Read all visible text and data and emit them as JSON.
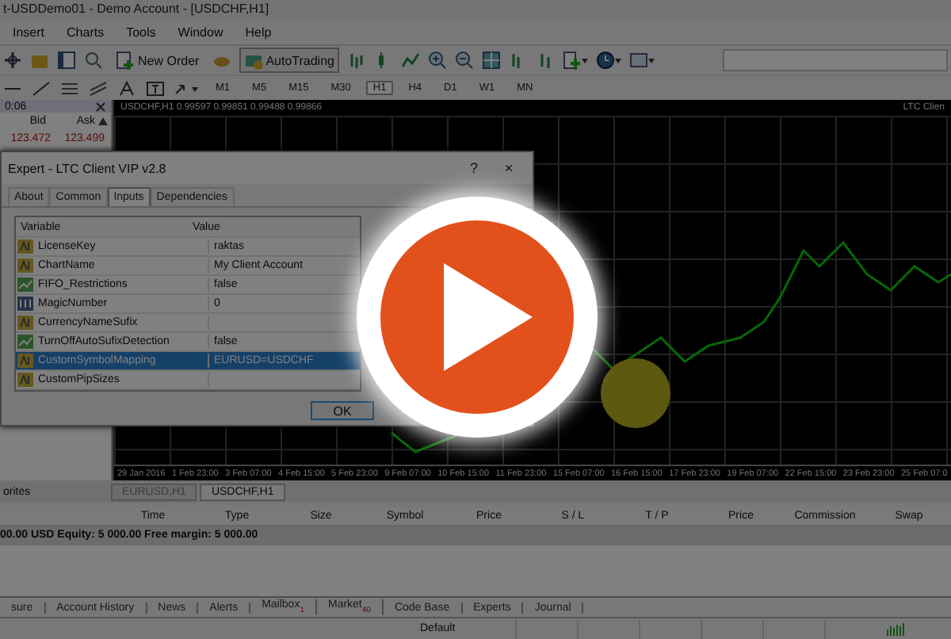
{
  "window": {
    "title": "t-USDDemo01 - Demo Account - [USDCHF,H1]"
  },
  "menu": [
    "Insert",
    "Charts",
    "Tools",
    "Window",
    "Help"
  ],
  "toolbar": {
    "buttons": [
      "New Order",
      "AutoTrading"
    ]
  },
  "timeframes": [
    {
      "label": "M1",
      "selected": false
    },
    {
      "label": "M5",
      "selected": false
    },
    {
      "label": "M15",
      "selected": false
    },
    {
      "label": "M30",
      "selected": false
    },
    {
      "label": "H1",
      "selected": true
    },
    {
      "label": "H4",
      "selected": false
    },
    {
      "label": "D1",
      "selected": false
    },
    {
      "label": "W1",
      "selected": false
    },
    {
      "label": "MN",
      "selected": false
    }
  ],
  "market_watch": {
    "header": "0:06",
    "columns": [
      "Bid",
      "Ask"
    ],
    "rows": [
      [
        "123.472",
        "123.499"
      ]
    ]
  },
  "chart": {
    "header": "USDCHF,H1  0.99597 0.99851 0.99488 0.99866",
    "expert_label": "LTC Clien",
    "x_labels": [
      "29 Jan 2016",
      "1 Feb 23:00",
      "3 Feb 07:00",
      "4 Feb 15:00",
      "5 Feb 23:00",
      "9 Feb 07:00",
      "10 Feb 15:00",
      "11 Feb 23:00",
      "15 Feb 07:00",
      "16 Feb 15:00",
      "17 Feb 23:00",
      "19 Feb 07:00",
      "22 Feb 15:00",
      "23 Feb 23:00",
      "25 Feb 07:0"
    ]
  },
  "dialog": {
    "title": "Expert - LTC Client VIP v2.8",
    "help": "?",
    "close": "×",
    "tabs": [
      {
        "label": "About",
        "selected": false
      },
      {
        "label": "Common",
        "selected": false
      },
      {
        "label": "Inputs",
        "selected": true
      },
      {
        "label": "Dependencies",
        "selected": false
      }
    ],
    "columns": [
      "Variable",
      "Value"
    ],
    "rows": [
      {
        "kind": "string",
        "variable": "LicenseKey",
        "value": "raktas",
        "selected": false
      },
      {
        "kind": "string",
        "variable": "ChartName",
        "value": "My Client Account",
        "selected": false
      },
      {
        "kind": "bool",
        "variable": "FIFO_Restrictions",
        "value": "false",
        "selected": false
      },
      {
        "kind": "int",
        "variable": "MagicNumber",
        "value": "0",
        "selected": false
      },
      {
        "kind": "string",
        "variable": "CurrencyNameSufix",
        "selected": false
      },
      {
        "kind": "bool",
        "variable": "TurnOffAutoSufixDetection",
        "value": "false",
        "selected": false
      },
      {
        "kind": "string",
        "variable": "CustomSymbolMapping",
        "value": "EURUSD=USDCHF",
        "selected": true
      },
      {
        "kind": "string",
        "variable": "CustomPipSizes",
        "selected": false
      }
    ],
    "ok": "OK"
  },
  "navigator_tab": "orites",
  "chart_tabs": [
    {
      "label": "EURUSD,H1",
      "selected": false
    },
    {
      "label": "USDCHF,H1",
      "selected": true
    }
  ],
  "terminal": {
    "columns": [
      "Time",
      "Type",
      "Size",
      "Symbol",
      "Price",
      "S / L",
      "T / P",
      "Price",
      "Commission",
      "Swap"
    ],
    "balance": "00.00 USD  Equity: 5 000.00  Free margin: 5 000.00",
    "tabs": [
      {
        "label": "sure"
      },
      {
        "label": "Account History"
      },
      {
        "label": "News"
      },
      {
        "label": "Alerts"
      },
      {
        "label": "Mailbox",
        "badge": "1"
      },
      {
        "label": "Market",
        "badge": "40"
      },
      {
        "label": "Code Base"
      },
      {
        "label": "Experts"
      },
      {
        "label": "Journal"
      }
    ]
  },
  "status_bar": [
    "Default"
  ]
}
